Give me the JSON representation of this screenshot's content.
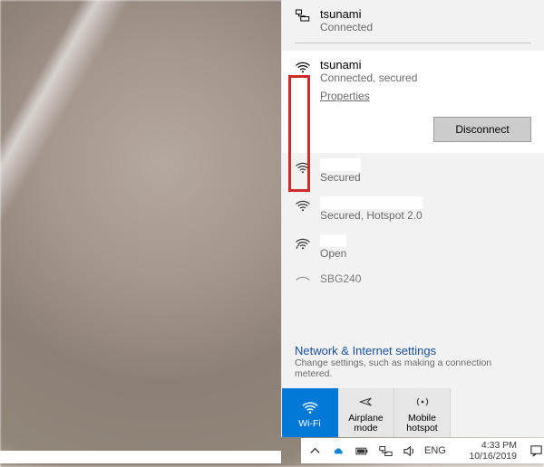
{
  "ethernet": {
    "name": "tsunami",
    "status": "Connected"
  },
  "selected_wifi": {
    "name": "tsunami",
    "status": "Connected, secured",
    "properties_label": "Properties",
    "disconnect_label": "Disconnect"
  },
  "other_networks": [
    {
      "name": "",
      "status": "Secured"
    },
    {
      "name": "",
      "status": "Secured, Hotspot 2.0"
    },
    {
      "name": "",
      "status": "Open"
    }
  ],
  "peek_network": "SBG240",
  "settings": {
    "title": "Network & Internet settings",
    "subtitle": "Change settings, such as making a connection metered."
  },
  "tiles": {
    "wifi": "Wi-Fi",
    "airplane": "Airplane mode",
    "hotspot": "Mobile hotspot"
  },
  "taskbar": {
    "lang": "ENG",
    "time": "4:33 PM",
    "date": "10/16/2019"
  }
}
